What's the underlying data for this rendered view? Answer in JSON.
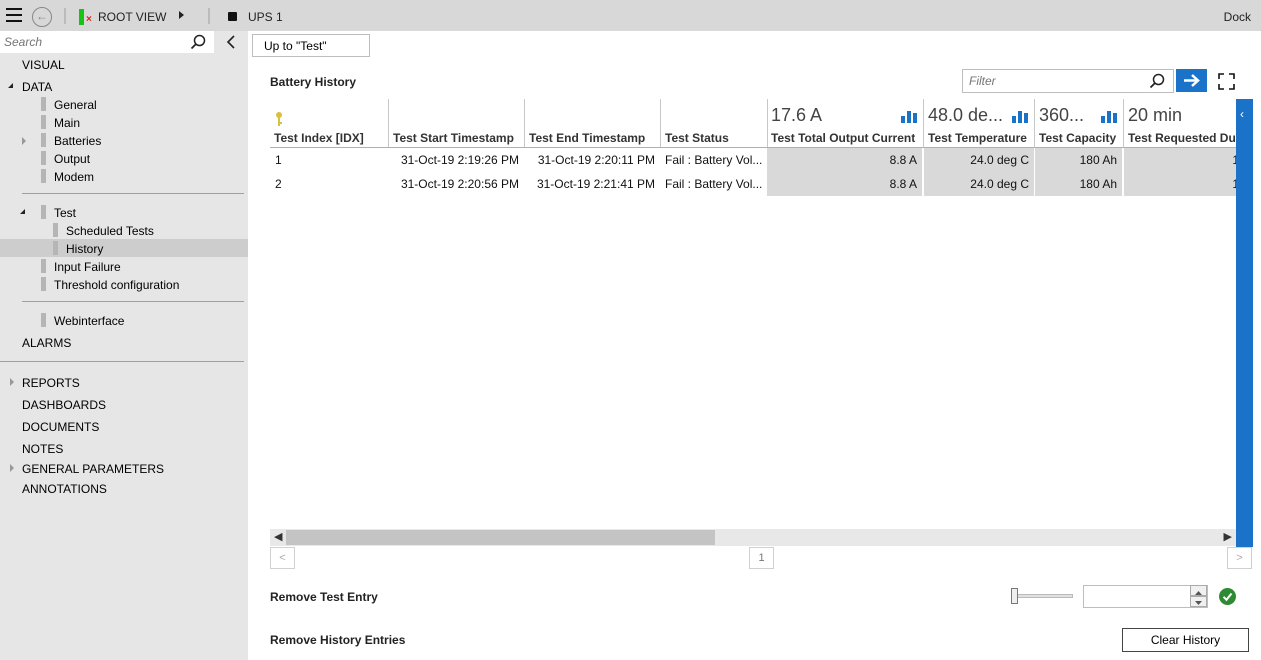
{
  "topbar": {
    "root_view": "ROOT VIEW",
    "device": "UPS 1",
    "dock": "Dock",
    "menu_icon": "hamburger-icon",
    "back_icon": "back-arrow-icon"
  },
  "sidebar": {
    "search_placeholder": "Search",
    "items": {
      "visual": "VISUAL",
      "data": "DATA",
      "general": "General",
      "main": "Main",
      "batteries": "Batteries",
      "output": "Output",
      "modem": "Modem",
      "test": "Test",
      "scheduled_tests": "Scheduled Tests",
      "history": "History",
      "input_failure": "Input Failure",
      "threshold": "Threshold configuration",
      "webinterface": "Webinterface",
      "alarms": "ALARMS",
      "reports": "REPORTS",
      "dashboards": "DASHBOARDS",
      "documents": "DOCUMENTS",
      "notes": "NOTES",
      "general_parameters": "GENERAL PARAMETERS",
      "annotations": "ANNOTATIONS"
    },
    "selected": "History"
  },
  "main": {
    "up_button": "Up to \"Test\"",
    "title": "Battery History",
    "filter_placeholder": "Filter",
    "accent_color": "#1a73c9",
    "table": {
      "columns": [
        {
          "name": "Test Index [IDX]",
          "agg": ""
        },
        {
          "name": "Test Start Timestamp",
          "agg": ""
        },
        {
          "name": "Test End Timestamp",
          "agg": ""
        },
        {
          "name": "Test Status",
          "agg": ""
        },
        {
          "name": "Test Total Output Current",
          "agg": "17.6 A"
        },
        {
          "name": "Test Temperature",
          "agg": "48.0 de..."
        },
        {
          "name": "Test Capacity",
          "agg": "360..."
        },
        {
          "name": "Test Requested Dur",
          "agg": "20 min"
        }
      ],
      "rows": [
        [
          "1",
          "31-Oct-19 2:19:26 PM",
          "31-Oct-19 2:20:11 PM",
          "Fail : Battery Vol...",
          "8.8 A",
          "24.0 deg C",
          "180 Ah",
          "1"
        ],
        [
          "2",
          "31-Oct-19 2:20:56 PM",
          "31-Oct-19 2:21:41 PM",
          "Fail : Battery Vol...",
          "8.8 A",
          "24.0 deg C",
          "180 Ah",
          "1"
        ]
      ]
    },
    "pager": {
      "prev": "<",
      "page": "1",
      "next": ">"
    },
    "remove_test_entry": "Remove Test Entry",
    "remove_history_entries": "Remove History Entries",
    "clear_history": "Clear History",
    "slider_value": 0
  }
}
